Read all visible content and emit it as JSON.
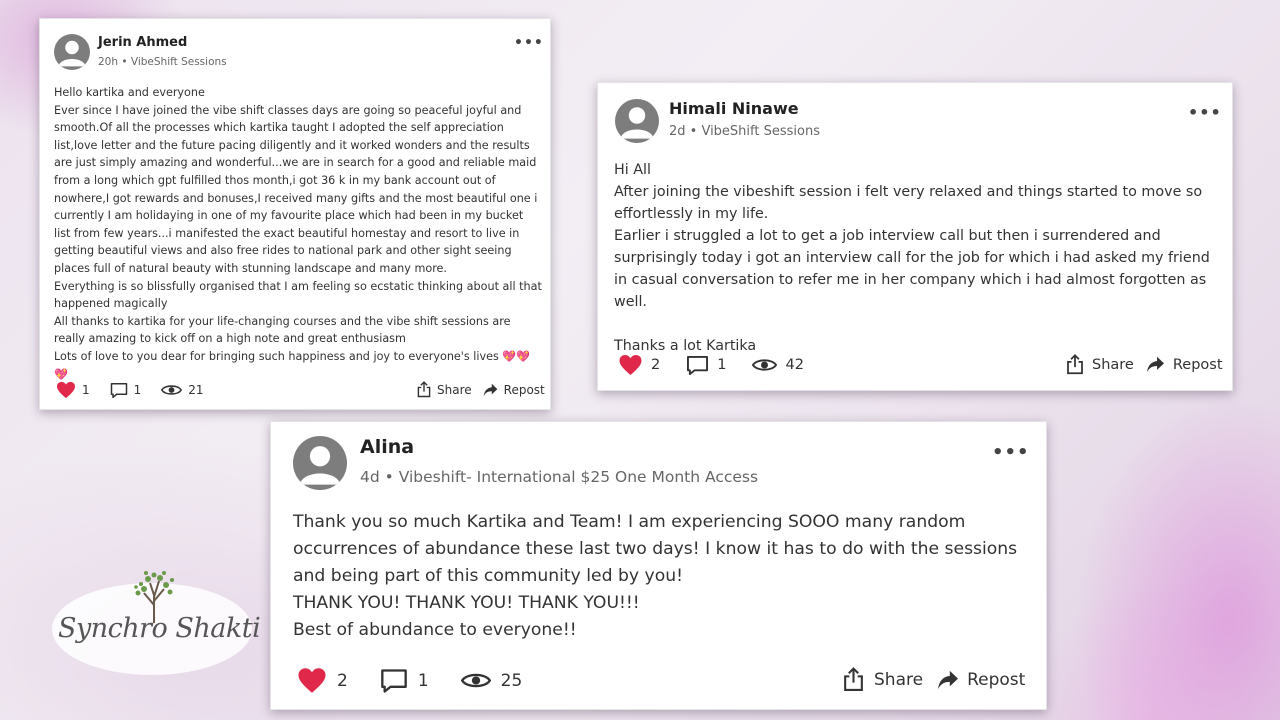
{
  "logo": {
    "text": "Synchro Shakti"
  },
  "posts": [
    {
      "author": "Jerin Ahmed",
      "meta": "20h • VibeShift Sessions",
      "more": "•••",
      "body": [
        "Hello kartika and everyone",
        "Ever since I have joined the vibe shift classes days are going so peaceful joyful and smooth.Of all the processes which kartika taught I adopted the self appreciation list,love letter and the future pacing diligently and it worked wonders and the results are just simply amazing and wonderful...we are in search for a good and reliable maid from a long which gpt fulfilled thos month,i got 36 k in my bank account out of nowhere,I got rewards and bonuses,I received many gifts and the most beautiful one i currently I am holidaying in one of my favourite place which had been in my bucket list from few years...i manifested the exact beautiful homestay and resort to live in getting beautiful views and also free rides to national park and other sight seeing places full of natural beauty with stunning landscape and many more.",
        "Everything is so blissfully organised that I am feeling so ecstatic thinking about all that happened magically",
        "All thanks to kartika for your life-changing courses and the vibe shift sessions are really amazing to kick off on a high note and great enthusiasm",
        "Lots of love to you dear for bringing such happiness and joy to everyone's lives 💖💖💖"
      ],
      "likes": "1",
      "comments": "1",
      "views": "21",
      "share": "Share",
      "repost": "Repost"
    },
    {
      "author": "Himali Ninawe",
      "meta": "2d • VibeShift Sessions",
      "more": "•••",
      "body": [
        "Hi All",
        "After joining the vibeshift session i felt very relaxed and things started to move so effortlessly in my life.",
        "Earlier i struggled a lot to get a job interview call but then i surrendered and surprisingly today i got an interview call for the job for which i had  asked my friend in casual conversation to refer me in her company which i had almost forgotten as well.",
        " ",
        "Thanks a lot Kartika"
      ],
      "likes": "2",
      "comments": "1",
      "views": "42",
      "share": "Share",
      "repost": "Repost"
    },
    {
      "author": "Alina",
      "meta": "4d • Vibeshift- International $25 One Month Access",
      "more": "•••",
      "body": [
        "Thank you so much Kartika and Team!  I am experiencing SOOO many random occurrences of abundance these last two days!  I know it has to do with the sessions and being part of this community led by you!",
        "THANK YOU!   THANK YOU!  THANK YOU!!!",
        "Best of abundance to everyone!!"
      ],
      "likes": "2",
      "comments": "1",
      "views": "25",
      "share": "Share",
      "repost": "Repost"
    }
  ],
  "colors": {
    "heart": "#e0294a",
    "avatar": "#7d7d7d",
    "text": "#333333"
  }
}
